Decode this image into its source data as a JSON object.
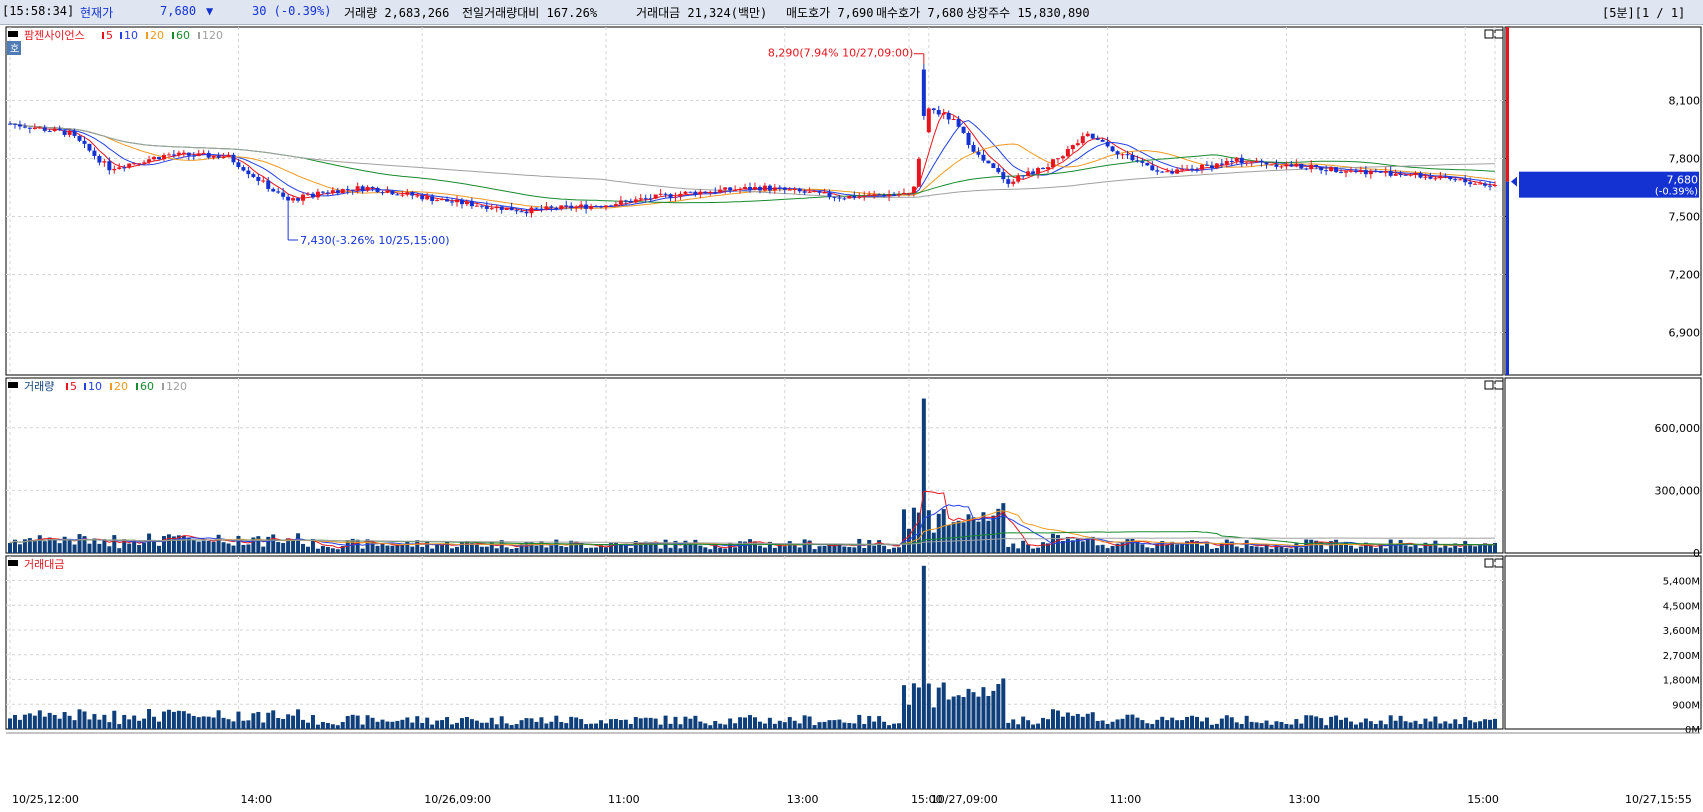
{
  "header": {
    "time": "[15:58:34]",
    "price_label": "현재가",
    "price": "7,680",
    "change_arrow": "▼",
    "change": "30 (-0.39%)",
    "volume": "거래량 2,683,266",
    "vol_ratio": "전일거래량대비 167.26%",
    "amount": "거래대금 21,324(백만)",
    "ask": "매도호가 7,690",
    "bid": "매수호가 7,680",
    "shares": "상장주수 15,830,890",
    "right": "[5분][1 / 1]"
  },
  "colors": {
    "up": "#e8141e",
    "down": "#1432d2",
    "ma5": "#e8141e",
    "ma10": "#2440e8",
    "ma20": "#f09a20",
    "ma60": "#188a2e",
    "ma120": "#a0a0a0",
    "volume_bar": "#0e3f7a",
    "panel_border": "#000000",
    "grid": "#d4d4d4"
  },
  "panels": {
    "price": {
      "legend_name": "팜젠사이언스",
      "legend_periods": [
        "5",
        "10",
        "20",
        "60",
        "120"
      ],
      "badge": "호",
      "high_annotation": "8,290(7.94% 10/27,09:00)",
      "low_annotation": "7,430(-3.26% 10/25,15:00)",
      "current_tag": "7,680",
      "current_change_tag": "(-0.39%)"
    },
    "volume": {
      "legend_name": "거래량",
      "legend_periods": [
        "5",
        "10",
        "20",
        "60",
        "120"
      ]
    },
    "amount": {
      "legend_name": "거래대금"
    }
  },
  "x_labels": [
    "10/25,12:00",
    "14:00",
    "10/26,09:00",
    "11:00",
    "13:00",
    "15:00",
    "10/27,09:00",
    "11:00",
    "13:00",
    "15:00",
    "10/27,15:55"
  ],
  "chart_data": [
    {
      "type": "candlestick",
      "y_ticks": [
        "8,100",
        "7,800",
        "7,500",
        "7,200",
        "6,900"
      ],
      "ylim": [
        6680,
        8480
      ],
      "high": 8290,
      "low": 7430,
      "last": 7680,
      "series": [
        {
          "name": "5"
        },
        {
          "name": "10"
        },
        {
          "name": "20"
        },
        {
          "name": "60"
        },
        {
          "name": "120"
        }
      ]
    },
    {
      "type": "bar",
      "y_ticks": [
        "600,000",
        "300,000",
        "0"
      ],
      "ylim": [
        0,
        800000
      ],
      "peak": 740000
    },
    {
      "type": "bar",
      "y_ticks": [
        "5,400M",
        "4,500M",
        "3,600M",
        "2,700M",
        "1,800M",
        "900M",
        "0M"
      ],
      "ylim": [
        0,
        6000
      ],
      "peak": 5800
    }
  ]
}
